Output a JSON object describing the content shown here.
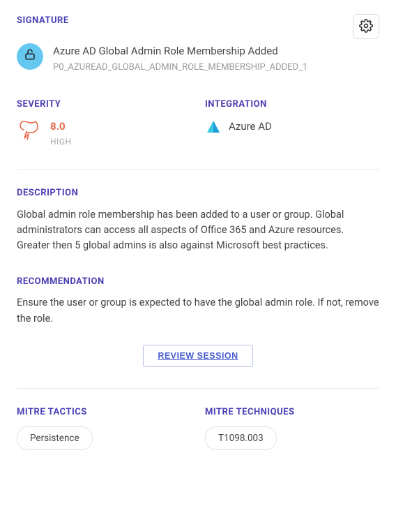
{
  "labels": {
    "signature": "SIGNATURE",
    "severity": "SEVERITY",
    "integration": "INTEGRATION",
    "description": "DESCRIPTION",
    "recommendation": "RECOMMENDATION",
    "mitre_tactics": "MITRE TACTICS",
    "mitre_techniques": "MITRE TECHNIQUES"
  },
  "signature": {
    "title": "Azure AD Global Admin Role Membership Added",
    "id": "P0_AZUREAD_GLOBAL_ADMIN_ROLE_MEMBERSHIP_ADDED_1"
  },
  "severity": {
    "score": "8.0",
    "label": "HIGH",
    "color": "#e8694a"
  },
  "integration": {
    "name": "Azure AD"
  },
  "description": "Global admin role membership has been added to a user or group. Global administrators can access all aspects of Office 365 and Azure resources. Greater then 5 global admins is also against Microsoft best practices.",
  "recommendation": "Ensure the user or group is expected to have the global admin role. If not, remove the role.",
  "review_button": "REVIEW SESSION",
  "mitre": {
    "tactics": [
      "Persistence"
    ],
    "techniques": [
      "T1098.003"
    ]
  }
}
